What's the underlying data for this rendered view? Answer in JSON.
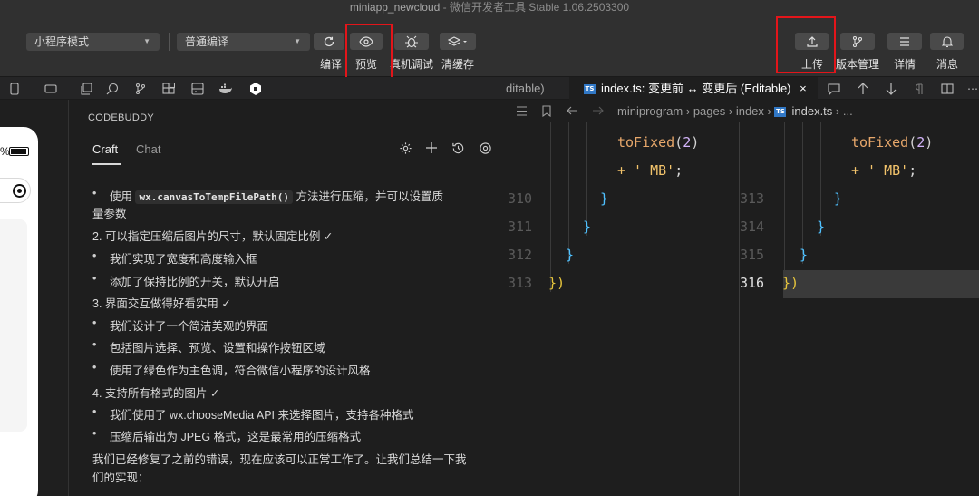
{
  "window": {
    "app_name": "miniapp_newcloud",
    "subtitle": " - 微信开发者工具 Stable 1.06.2503300"
  },
  "toolbar": {
    "mode_select": "小程序模式",
    "compile_select": "普通编译",
    "labels": {
      "compile": "编译",
      "preview": "预览",
      "remote_debug": "真机调试",
      "clear_cache": "清缓存",
      "upload": "上传",
      "version": "版本管理",
      "details": "详情",
      "messages": "消息"
    },
    "highlight_color": "#e3151a"
  },
  "phone": {
    "battery_text": "%"
  },
  "codebuddy": {
    "header": "CODEBUDDY",
    "tabs": [
      "Craft",
      "Chat"
    ],
    "active_tab": "Craft",
    "lines": [
      {
        "bullet": true,
        "pre": "使用 ",
        "code": "wx.canvasToTempFilePath()",
        "post": " 方法进行压缩，并可以设置质"
      },
      {
        "bullet": false,
        "text": "量参数"
      },
      {
        "bullet": false,
        "text": "2. 可以指定压缩后图片的尺寸，默认固定比例 ✓"
      },
      {
        "bullet": true,
        "text": "我们实现了宽度和高度输入框"
      },
      {
        "bullet": true,
        "text": "添加了保持比例的开关，默认开启"
      },
      {
        "bullet": false,
        "text": "3. 界面交互做得好看实用 ✓"
      },
      {
        "bullet": true,
        "text": "我们设计了一个简洁美观的界面"
      },
      {
        "bullet": true,
        "text": "包括图片选择、预览、设置和操作按钮区域"
      },
      {
        "bullet": true,
        "text": "使用了绿色作为主色调，符合微信小程序的设计风格"
      },
      {
        "bullet": false,
        "text": "4. 支持所有格式的图片 ✓"
      },
      {
        "bullet": true,
        "text": "我们使用了 wx.chooseMedia API 来选择图片，支持各种格式"
      },
      {
        "bullet": true,
        "text": "压缩后输出为 JPEG 格式，这是最常用的压缩格式"
      },
      {
        "bullet": false,
        "text": "我们已经修复了之前的错误，现在应该可以正常工作了。让我们总结一下我"
      },
      {
        "bullet": false,
        "text": "们的实现："
      }
    ]
  },
  "editor": {
    "tab_prev": "ditable)",
    "tab_active": "index.ts: 变更前 ↔ 变更后 (Editable)",
    "tab_close": "×",
    "ts_badge": "TS",
    "breadcrumb": [
      "miniprogram",
      "pages",
      "index",
      "index.ts",
      "..."
    ],
    "left": {
      "lines": [
        {
          "num": "",
          "code": "toFixed(2)"
        },
        {
          "num": "",
          "code": "+ ' MB';"
        },
        {
          "num": "310",
          "code": "}"
        },
        {
          "num": "311",
          "code": "}"
        },
        {
          "num": "312",
          "code": "}"
        },
        {
          "num": "313",
          "code": "})"
        }
      ]
    },
    "right": {
      "lines": [
        {
          "num": "",
          "code": "toFixed(2)"
        },
        {
          "num": "",
          "code": "+ ' MB';"
        },
        {
          "num": "313",
          "code": "}"
        },
        {
          "num": "314",
          "code": "}"
        },
        {
          "num": "315",
          "code": "}"
        },
        {
          "num": "316",
          "code": "})"
        }
      ]
    }
  }
}
